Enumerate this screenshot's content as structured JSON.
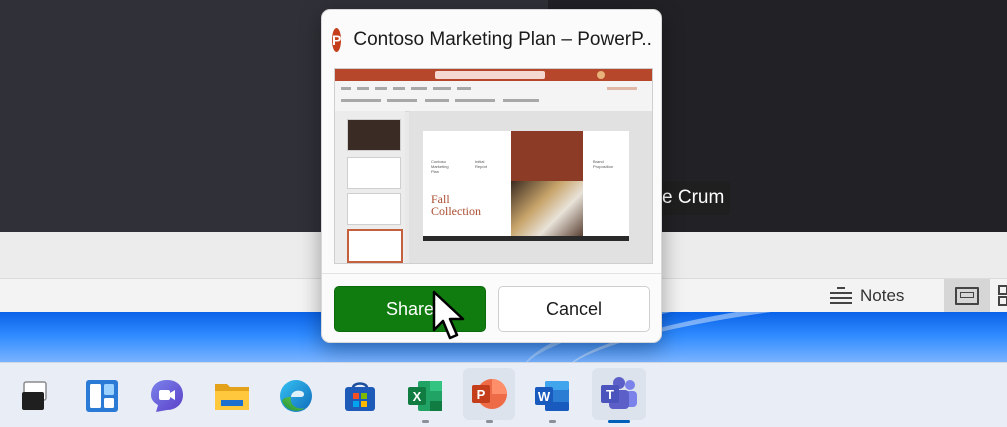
{
  "meeting": {
    "participant_name_fragment": "e Crum"
  },
  "share_dialog": {
    "app_badge_letter": "P",
    "title": "Contoso Marketing Plan – PowerP..",
    "share_label": "Share",
    "cancel_label": "Cancel",
    "preview_slide_text": "Fall Collection",
    "colors": {
      "share_button": "#107c10",
      "powerpoint_accent": "#c43e1c"
    }
  },
  "powerpoint_statusbar": {
    "notes_label": "Notes"
  },
  "taskbar": {
    "apps": [
      {
        "name": "Task View",
        "icon": "task-view-icon",
        "open": false
      },
      {
        "name": "Widgets",
        "icon": "widgets-icon",
        "open": false
      },
      {
        "name": "Chat",
        "icon": "chat-icon",
        "open": false
      },
      {
        "name": "File Explorer",
        "icon": "file-explorer-icon",
        "open": false
      },
      {
        "name": "Microsoft Edge",
        "icon": "edge-icon",
        "open": false
      },
      {
        "name": "Microsoft Store",
        "icon": "store-icon",
        "open": false
      },
      {
        "name": "Excel",
        "icon": "excel-icon",
        "letter": "X",
        "open": true
      },
      {
        "name": "PowerPoint",
        "icon": "powerpoint-icon",
        "letter": "P",
        "open": true
      },
      {
        "name": "Word",
        "icon": "word-icon",
        "letter": "W",
        "open": true
      },
      {
        "name": "Teams",
        "icon": "teams-icon",
        "letter": "T",
        "open": true,
        "active": true
      }
    ]
  }
}
